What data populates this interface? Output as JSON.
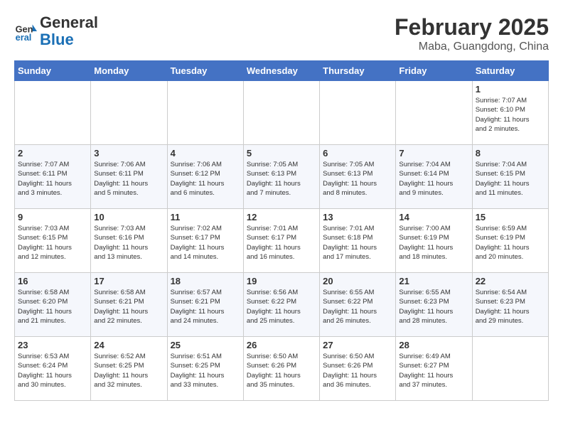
{
  "logo": {
    "line1": "General",
    "line2": "Blue"
  },
  "title": "February 2025",
  "subtitle": "Maba, Guangdong, China",
  "days_of_week": [
    "Sunday",
    "Monday",
    "Tuesday",
    "Wednesday",
    "Thursday",
    "Friday",
    "Saturday"
  ],
  "weeks": [
    [
      {
        "day": "",
        "info": ""
      },
      {
        "day": "",
        "info": ""
      },
      {
        "day": "",
        "info": ""
      },
      {
        "day": "",
        "info": ""
      },
      {
        "day": "",
        "info": ""
      },
      {
        "day": "",
        "info": ""
      },
      {
        "day": "1",
        "info": "Sunrise: 7:07 AM\nSunset: 6:10 PM\nDaylight: 11 hours\nand 2 minutes."
      }
    ],
    [
      {
        "day": "2",
        "info": "Sunrise: 7:07 AM\nSunset: 6:11 PM\nDaylight: 11 hours\nand 3 minutes."
      },
      {
        "day": "3",
        "info": "Sunrise: 7:06 AM\nSunset: 6:11 PM\nDaylight: 11 hours\nand 5 minutes."
      },
      {
        "day": "4",
        "info": "Sunrise: 7:06 AM\nSunset: 6:12 PM\nDaylight: 11 hours\nand 6 minutes."
      },
      {
        "day": "5",
        "info": "Sunrise: 7:05 AM\nSunset: 6:13 PM\nDaylight: 11 hours\nand 7 minutes."
      },
      {
        "day": "6",
        "info": "Sunrise: 7:05 AM\nSunset: 6:13 PM\nDaylight: 11 hours\nand 8 minutes."
      },
      {
        "day": "7",
        "info": "Sunrise: 7:04 AM\nSunset: 6:14 PM\nDaylight: 11 hours\nand 9 minutes."
      },
      {
        "day": "8",
        "info": "Sunrise: 7:04 AM\nSunset: 6:15 PM\nDaylight: 11 hours\nand 11 minutes."
      }
    ],
    [
      {
        "day": "9",
        "info": "Sunrise: 7:03 AM\nSunset: 6:15 PM\nDaylight: 11 hours\nand 12 minutes."
      },
      {
        "day": "10",
        "info": "Sunrise: 7:03 AM\nSunset: 6:16 PM\nDaylight: 11 hours\nand 13 minutes."
      },
      {
        "day": "11",
        "info": "Sunrise: 7:02 AM\nSunset: 6:17 PM\nDaylight: 11 hours\nand 14 minutes."
      },
      {
        "day": "12",
        "info": "Sunrise: 7:01 AM\nSunset: 6:17 PM\nDaylight: 11 hours\nand 16 minutes."
      },
      {
        "day": "13",
        "info": "Sunrise: 7:01 AM\nSunset: 6:18 PM\nDaylight: 11 hours\nand 17 minutes."
      },
      {
        "day": "14",
        "info": "Sunrise: 7:00 AM\nSunset: 6:19 PM\nDaylight: 11 hours\nand 18 minutes."
      },
      {
        "day": "15",
        "info": "Sunrise: 6:59 AM\nSunset: 6:19 PM\nDaylight: 11 hours\nand 20 minutes."
      }
    ],
    [
      {
        "day": "16",
        "info": "Sunrise: 6:58 AM\nSunset: 6:20 PM\nDaylight: 11 hours\nand 21 minutes."
      },
      {
        "day": "17",
        "info": "Sunrise: 6:58 AM\nSunset: 6:21 PM\nDaylight: 11 hours\nand 22 minutes."
      },
      {
        "day": "18",
        "info": "Sunrise: 6:57 AM\nSunset: 6:21 PM\nDaylight: 11 hours\nand 24 minutes."
      },
      {
        "day": "19",
        "info": "Sunrise: 6:56 AM\nSunset: 6:22 PM\nDaylight: 11 hours\nand 25 minutes."
      },
      {
        "day": "20",
        "info": "Sunrise: 6:55 AM\nSunset: 6:22 PM\nDaylight: 11 hours\nand 26 minutes."
      },
      {
        "day": "21",
        "info": "Sunrise: 6:55 AM\nSunset: 6:23 PM\nDaylight: 11 hours\nand 28 minutes."
      },
      {
        "day": "22",
        "info": "Sunrise: 6:54 AM\nSunset: 6:23 PM\nDaylight: 11 hours\nand 29 minutes."
      }
    ],
    [
      {
        "day": "23",
        "info": "Sunrise: 6:53 AM\nSunset: 6:24 PM\nDaylight: 11 hours\nand 30 minutes."
      },
      {
        "day": "24",
        "info": "Sunrise: 6:52 AM\nSunset: 6:25 PM\nDaylight: 11 hours\nand 32 minutes."
      },
      {
        "day": "25",
        "info": "Sunrise: 6:51 AM\nSunset: 6:25 PM\nDaylight: 11 hours\nand 33 minutes."
      },
      {
        "day": "26",
        "info": "Sunrise: 6:50 AM\nSunset: 6:26 PM\nDaylight: 11 hours\nand 35 minutes."
      },
      {
        "day": "27",
        "info": "Sunrise: 6:50 AM\nSunset: 6:26 PM\nDaylight: 11 hours\nand 36 minutes."
      },
      {
        "day": "28",
        "info": "Sunrise: 6:49 AM\nSunset: 6:27 PM\nDaylight: 11 hours\nand 37 minutes."
      },
      {
        "day": "",
        "info": ""
      }
    ]
  ]
}
